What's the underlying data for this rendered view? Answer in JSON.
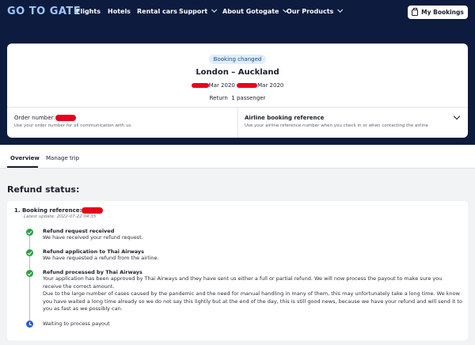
{
  "nav": {
    "logo": "GO TO GATE",
    "items": [
      "Flights",
      "Hotels",
      "Rental cars",
      "Support",
      "About Gotogate",
      "Our Products"
    ],
    "my_bookings": "My Bookings"
  },
  "booking": {
    "badge": "Booking changed",
    "route": "London – Auckland",
    "date_out_suffix": "Mar 2020",
    "date_in_suffix": "Mar 2020",
    "trip_type": "Return",
    "passengers": "1 passenger",
    "order_label": "Order number:",
    "order_sub": "Use your order number for all communication with us.",
    "airline_label": "Airline booking reference",
    "airline_sub": "Use your airline reference number when you check in or when contacting the airline"
  },
  "tabs": [
    "Overview",
    "Manage trip"
  ],
  "refund": {
    "title": "Refund status:",
    "booking_ref_label": "1.  Booking reference:",
    "last_update": "Latest update: 2022-07-22 04:35",
    "steps": [
      {
        "title": "Refund request received",
        "text": "We have received your refund request."
      },
      {
        "title": "Refund application to Thai Airways",
        "text": "We have requested a refund from the airline."
      },
      {
        "title": "Refund processed by Thai Airways",
        "text": "Your application has been approved by Thai Airways and they have sent us either a full or partial refund. We will now process the payout to make sure you receive the correct amount.",
        "text2": "Due to the large number of cases caused by the pandemic and the need for manual handling in many of them, this may unfortunately take a long time. We know you have waited a long time already so we do not say this lightly but at the end of the day, this is still good news, because we have your refund and will send it to you as fast as we possibly can."
      }
    ],
    "waiting": "Waiting to process payout"
  },
  "colors": {
    "nav_bg": "#0d1b3e",
    "logo": "#9ec7ff",
    "done": "#2ea043",
    "pending": "#2c5fd7",
    "redaction": "#e8001c"
  },
  "icons": [
    "chevron-down-icon",
    "bag-icon",
    "check-icon",
    "clock-icon"
  ]
}
